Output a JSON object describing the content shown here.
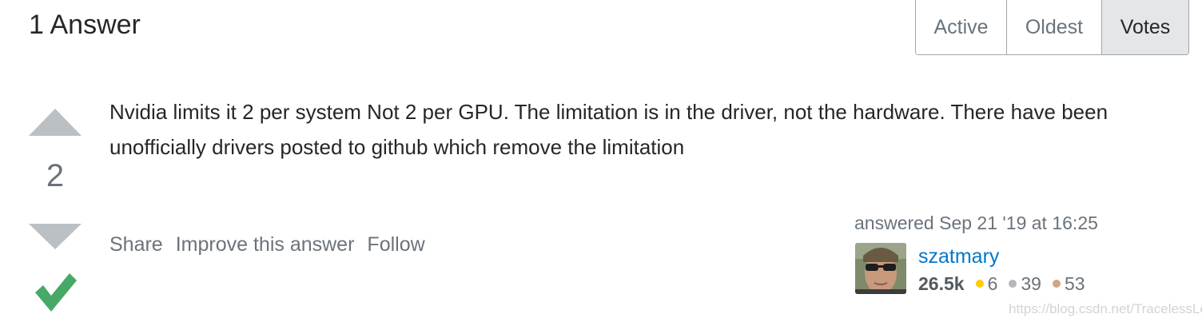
{
  "header": {
    "title": "1 Answer"
  },
  "sort_tabs": [
    "Active",
    "Oldest",
    "Votes"
  ],
  "answer": {
    "vote_count": "2",
    "body": "Nvidia limits it 2 per system Not 2 per GPU. The limitation is in the driver, not the hardware. There have been unofficially drivers posted to github which remove the limitation",
    "menu": {
      "share": "Share",
      "improve": "Improve this answer",
      "follow": "Follow"
    },
    "user": {
      "action_time": "answered Sep 21 '19 at 16:25",
      "name": "szatmary",
      "reputation": "26.5k",
      "gold": "6",
      "silver": "39",
      "bronze": "53"
    }
  },
  "watermark": "https://blog.csdn.net/TracelessLe",
  "colors": {
    "link": "#0077cc",
    "accepted": "#48a868",
    "vote_arrow": "#bbc0c4"
  }
}
